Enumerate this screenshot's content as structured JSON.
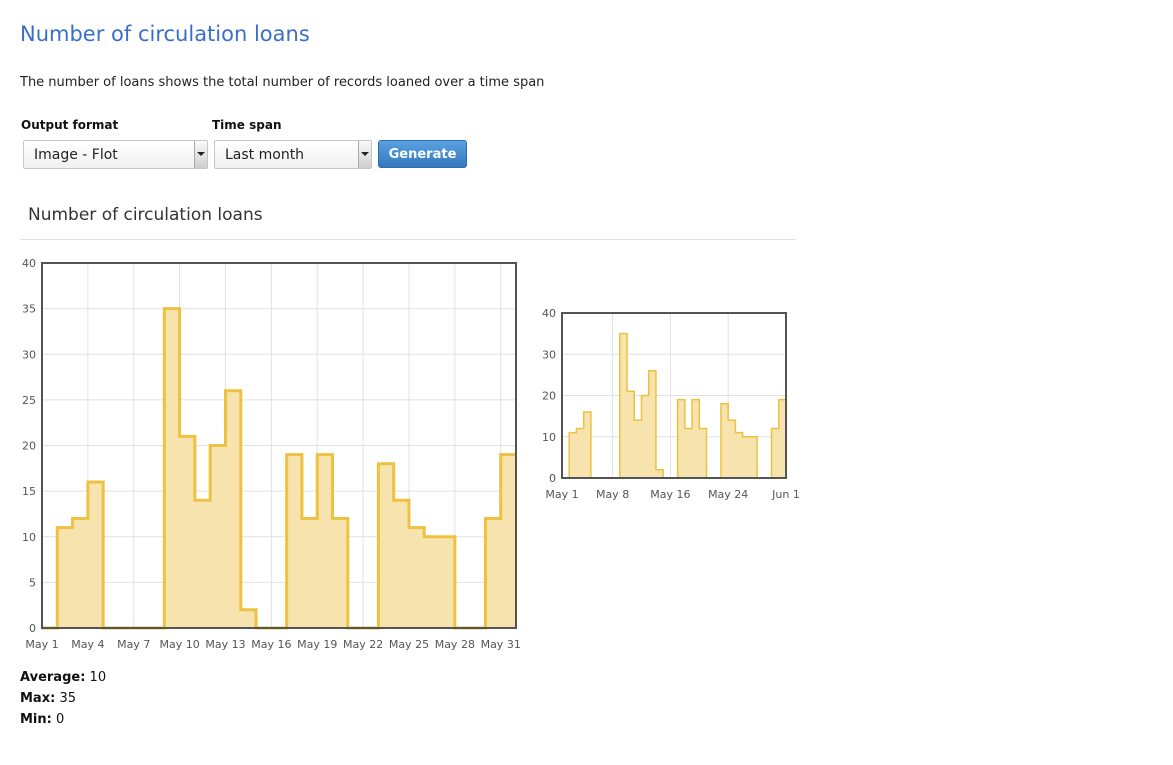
{
  "page": {
    "title": "Number of circulation loans",
    "description": "The number of loans shows the total number of records loaned over a time span"
  },
  "form": {
    "output_format_label": "Output format",
    "output_format_value": "Image - Flot",
    "time_span_label": "Time span",
    "time_span_value": "Last month",
    "generate_label": "Generate"
  },
  "section_title": "Number of circulation loans",
  "colors": {
    "link_blue": "#3a6fc9",
    "button_blue": "#3a7fc4",
    "fill": "#f7e3ae",
    "line": "#edc240"
  },
  "stats": {
    "average_label": "Average:",
    "average_value": "10",
    "max_label": "Max:",
    "max_value": "35",
    "min_label": "Min:",
    "min_value": "0"
  },
  "chart_data": [
    {
      "type": "area",
      "title": "",
      "xlabel": "",
      "ylabel": "",
      "ylim": [
        0,
        40
      ],
      "yticks": [
        0,
        5,
        10,
        15,
        20,
        25,
        30,
        35,
        40
      ],
      "xticks": [
        "May 1",
        "May 4",
        "May 7",
        "May 10",
        "May 13",
        "May 16",
        "May 19",
        "May 22",
        "May 25",
        "May 28",
        "May 31"
      ],
      "grid": true,
      "step": true,
      "x_range": [
        "May 1",
        "Jun 1"
      ],
      "x": [
        "May 1",
        "May 2",
        "May 3",
        "May 4",
        "May 5",
        "May 6",
        "May 7",
        "May 8",
        "May 9",
        "May 10",
        "May 11",
        "May 12",
        "May 13",
        "May 14",
        "May 15",
        "May 16",
        "May 17",
        "May 18",
        "May 19",
        "May 20",
        "May 21",
        "May 22",
        "May 23",
        "May 24",
        "May 25",
        "May 26",
        "May 27",
        "May 28",
        "May 29",
        "May 30",
        "May 31"
      ],
      "values": [
        0,
        11,
        12,
        16,
        0,
        0,
        0,
        0,
        35,
        21,
        14,
        20,
        26,
        2,
        0,
        0,
        19,
        12,
        19,
        12,
        0,
        0,
        18,
        14,
        11,
        10,
        10,
        0,
        0,
        12,
        19
      ]
    },
    {
      "type": "area",
      "title": "",
      "xlabel": "",
      "ylabel": "",
      "ylim": [
        0,
        40
      ],
      "yticks": [
        0,
        10,
        20,
        30,
        40
      ],
      "xticks": [
        "May 1",
        "May 8",
        "May 16",
        "May 24",
        "Jun 1"
      ],
      "grid": true,
      "step": true,
      "x_range": [
        "May 1",
        "Jun 1"
      ],
      "x": [
        "May 1",
        "May 2",
        "May 3",
        "May 4",
        "May 5",
        "May 6",
        "May 7",
        "May 8",
        "May 9",
        "May 10",
        "May 11",
        "May 12",
        "May 13",
        "May 14",
        "May 15",
        "May 16",
        "May 17",
        "May 18",
        "May 19",
        "May 20",
        "May 21",
        "May 22",
        "May 23",
        "May 24",
        "May 25",
        "May 26",
        "May 27",
        "May 28",
        "May 29",
        "May 30",
        "May 31"
      ],
      "values": [
        0,
        11,
        12,
        16,
        0,
        0,
        0,
        0,
        35,
        21,
        14,
        20,
        26,
        2,
        0,
        0,
        19,
        12,
        19,
        12,
        0,
        0,
        18,
        14,
        11,
        10,
        10,
        0,
        0,
        12,
        19
      ]
    }
  ]
}
